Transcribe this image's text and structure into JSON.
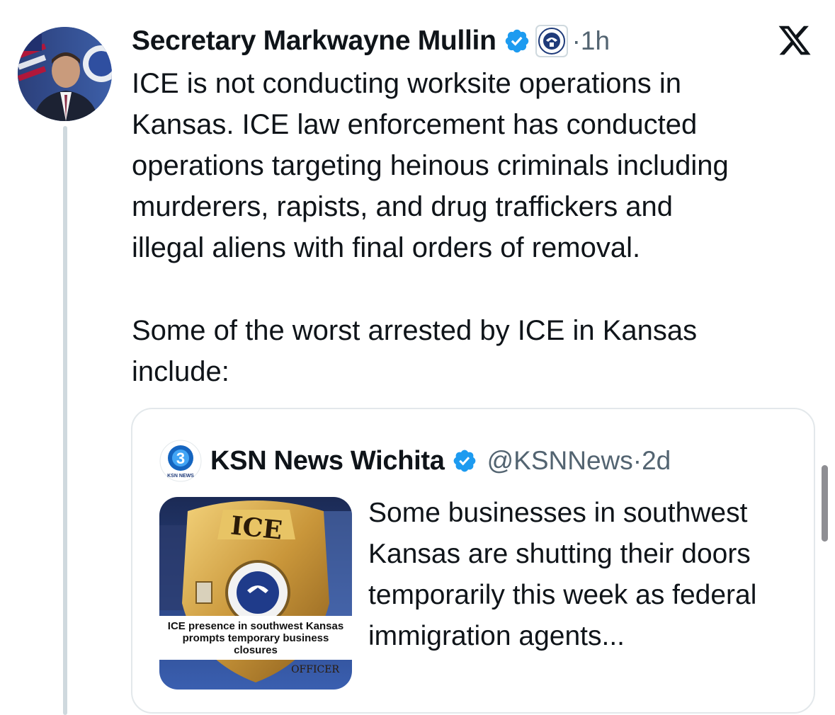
{
  "tweet": {
    "author_name": "Secretary Markwayne Mullin",
    "time": "·1h",
    "paragraph1": "ICE is not conducting worksite operations in\nKansas. ICE law enforcement has conducted\noperations targeting heinous criminals including\nmurderers, rapists, and drug traffickers and\nillegal aliens with final orders of removal.",
    "paragraph2": "Some of the worst arrested by ICE in Kansas\ninclude:"
  },
  "icons": {
    "verified": "verified-badge-icon",
    "affiliation": "dhs-seal-icon",
    "platform": "x-logo-icon"
  },
  "quote": {
    "author_name": "KSN News Wichita",
    "logo_text": "3",
    "logo_subtext": "KSN NEWS",
    "handle": "@KSNNews",
    "time": "·2d",
    "thumbnail_badge_text": "ICE",
    "thumbnail_caption": "ICE presence in southwest Kansas prompts temporary business closures",
    "thumbnail_footer_text": "OFFICER",
    "text": "Some businesses in southwest Kansas are shutting their doors temporarily this week as federal immigration agents..."
  },
  "colors": {
    "verified_blue": "#1d9bf0",
    "text_primary": "#0f1419",
    "text_secondary": "#536471",
    "border": "#e3e8eb"
  }
}
